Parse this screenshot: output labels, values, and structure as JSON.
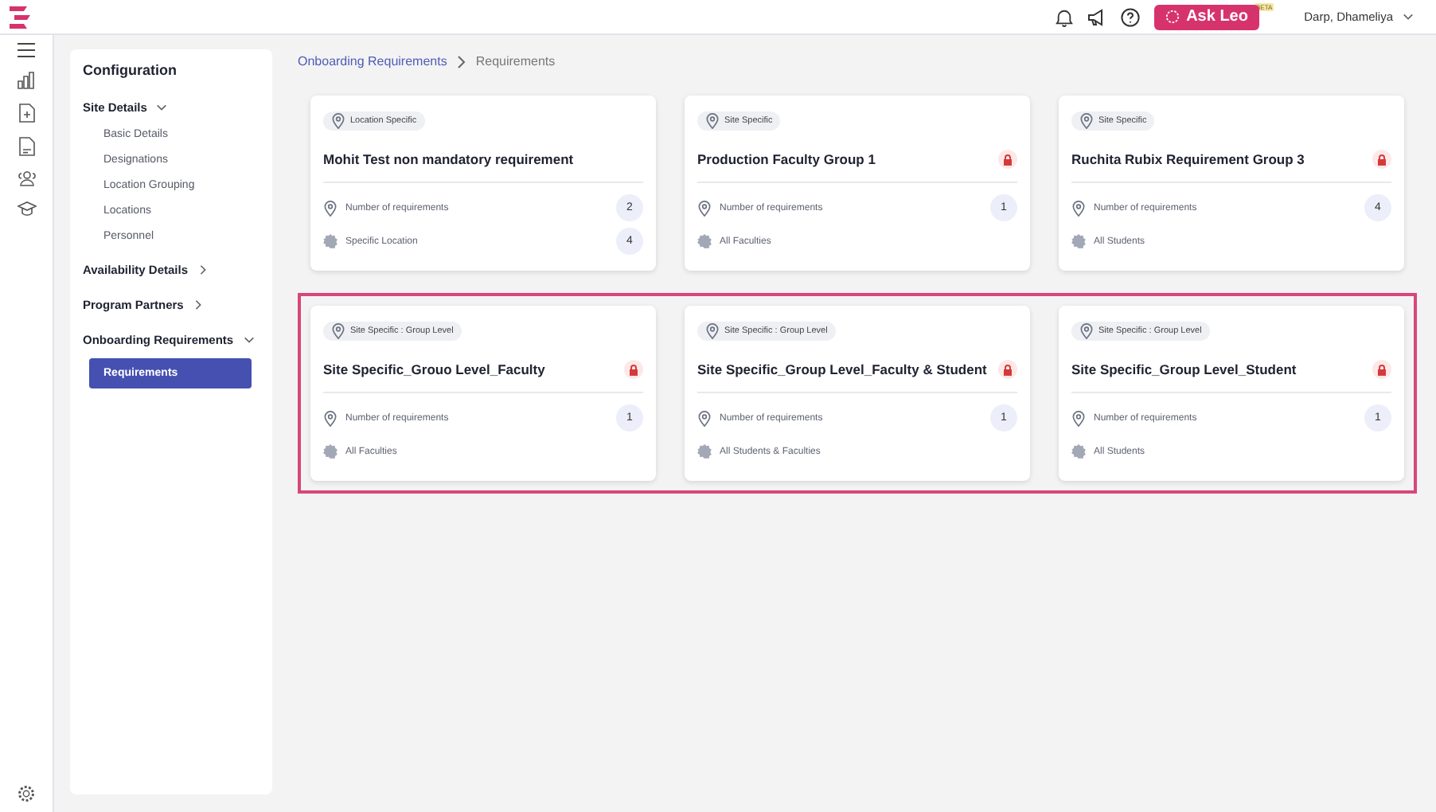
{
  "header": {
    "ask_button": "Ask Leo",
    "beta_badge": "BETA",
    "user": "Darp, Dhameliya"
  },
  "sidebar": {
    "title": "Configuration",
    "sections": [
      {
        "label": "Site Details",
        "expanded": true,
        "children": [
          {
            "label": "Basic Details",
            "selected": false
          },
          {
            "label": "Designations",
            "selected": false
          },
          {
            "label": "Location Grouping",
            "selected": false
          },
          {
            "label": "Locations",
            "selected": false
          },
          {
            "label": "Personnel",
            "selected": false
          }
        ]
      },
      {
        "label": "Availability Details",
        "expanded": false
      },
      {
        "label": "Program Partners",
        "expanded": false
      },
      {
        "label": "Onboarding Requirements",
        "expanded": true,
        "children": [
          {
            "label": "Requirements",
            "selected": true
          }
        ]
      }
    ]
  },
  "breadcrumb": [
    {
      "label": "Onboarding Requirements"
    },
    {
      "label": "Requirements"
    }
  ],
  "card_groups": [
    {
      "highlighted": false,
      "cards": [
        {
          "tag": "Location Specific",
          "title": "Mohit Test non mandatory requirement",
          "locked": false,
          "count_label": "Number of requirements",
          "count": "2",
          "scope": "Specific Location",
          "scope_count": "4"
        },
        {
          "tag": "Site Specific",
          "title": "Production Faculty Group 1",
          "locked": true,
          "count_label": "Number of requirements",
          "count": "1",
          "scope": "All Faculties"
        },
        {
          "tag": "Site Specific",
          "title": "Ruchita Rubix Requirement Group 3",
          "locked": true,
          "count_label": "Number of requirements",
          "count": "4",
          "scope": "All Students"
        }
      ]
    },
    {
      "highlighted": true,
      "cards": [
        {
          "tag": "Site Specific : Group Level",
          "title": "Site Specific_Grouo Level_Faculty",
          "locked": true,
          "count_label": "Number of requirements",
          "count": "1",
          "scope": "All Faculties"
        },
        {
          "tag": "Site Specific : Group Level",
          "title": "Site Specific_Group Level_Faculty & Student",
          "locked": true,
          "count_label": "Number of requirements",
          "count": "1",
          "scope": "All Students & Faculties"
        },
        {
          "tag": "Site Specific : Group Level",
          "title": "Site Specific_Group Level_Student",
          "locked": true,
          "count_label": "Number of requirements",
          "count": "1",
          "scope": "All Students"
        }
      ]
    }
  ]
}
